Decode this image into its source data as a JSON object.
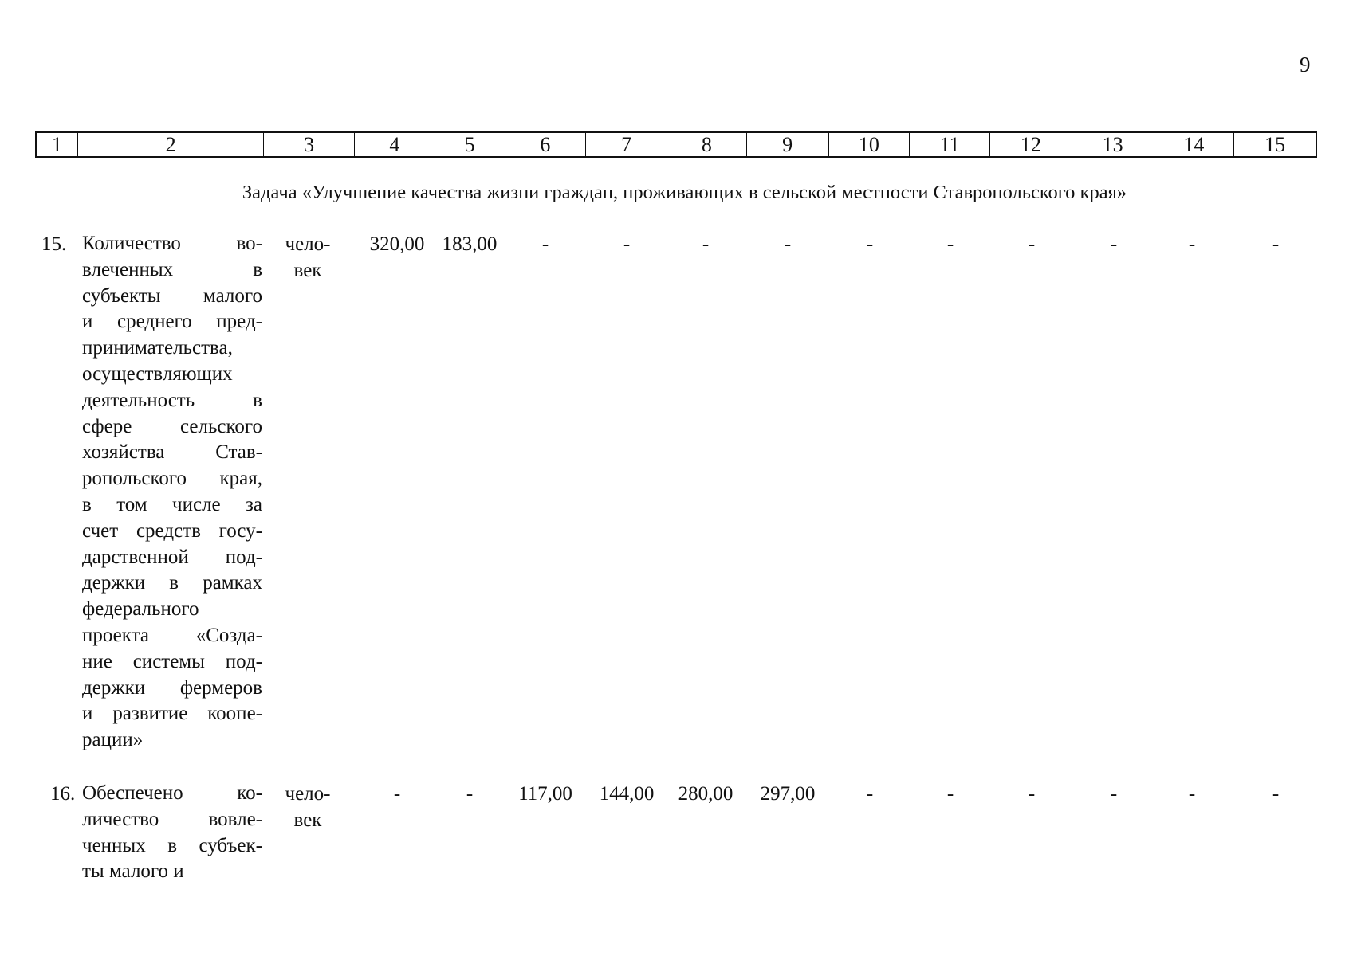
{
  "page_number": "9",
  "column_headers": [
    "1",
    "2",
    "3",
    "4",
    "5",
    "6",
    "7",
    "8",
    "9",
    "10",
    "11",
    "12",
    "13",
    "14",
    "15"
  ],
  "task_title": "Задача «Улучшение качества жизни граждан, проживающих в сельской местности Ставропольского края»",
  "rows": [
    {
      "number": "15.",
      "description_lines": [
        "Количество во-",
        "влеченных в",
        "субъекты малого",
        "и среднего пред-",
        "принимательства,",
        "осуществляющих",
        "деятельность в",
        "сфере сельского",
        "хозяйства Став-",
        "ропольского края,",
        "в том числе за",
        "счет средств госу-",
        "дарственной под-",
        "держки в рамках",
        "федерального",
        "проекта «Созда-",
        "ние системы под-",
        "держки фермеров",
        "и развитие коопе-",
        "рации»"
      ],
      "unit_lines": [
        "чело-",
        "век"
      ],
      "values": [
        "320,00",
        "183,00",
        "-",
        "-",
        "-",
        "-",
        "-",
        "-",
        "-",
        "-",
        "-",
        "-"
      ]
    },
    {
      "number": "16.",
      "description_lines": [
        "Обеспечено ко-",
        "личество вовле-",
        "ченных в субъек-",
        "ты малого и"
      ],
      "unit_lines": [
        "чело-",
        "век"
      ],
      "values": [
        "-",
        "-",
        "117,00",
        "144,00",
        "280,00",
        "297,00",
        "-",
        "-",
        "-",
        "-",
        "-",
        "-"
      ]
    }
  ]
}
